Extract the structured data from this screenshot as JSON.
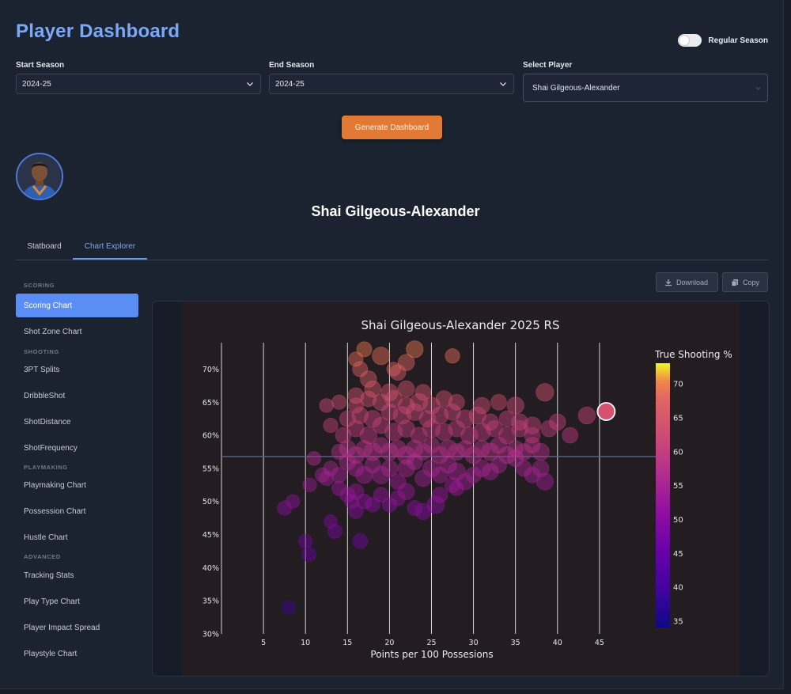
{
  "header": {
    "title": "Player Dashboard",
    "season_toggle_label": "Regular Season"
  },
  "filters": {
    "start_label": "Start Season",
    "start_value": "2024-25",
    "end_label": "End Season",
    "end_value": "2024-25",
    "player_label": "Select Player",
    "player_value": "Shai Gilgeous-Alexander"
  },
  "generate_label": "Generate Dashboard",
  "player": {
    "name": "Shai Gilgeous-Alexander"
  },
  "tabs": [
    {
      "label": "Statboard",
      "active": false
    },
    {
      "label": "Chart Explorer",
      "active": true
    }
  ],
  "sidebar": {
    "sections": [
      {
        "title": "SCORING",
        "items": [
          {
            "label": "Scoring Chart",
            "active": true
          },
          {
            "label": "Shot Zone Chart"
          }
        ]
      },
      {
        "title": "SHOOTING",
        "items": [
          {
            "label": "3PT Splits"
          },
          {
            "label": "DribbleShot"
          },
          {
            "label": "ShotDistance"
          },
          {
            "label": "ShotFrequency"
          }
        ]
      },
      {
        "title": "PLAYMAKING",
        "items": [
          {
            "label": "Playmaking Chart"
          },
          {
            "label": "Possession Chart"
          },
          {
            "label": "Hustle Chart"
          }
        ]
      },
      {
        "title": "ADVANCED",
        "items": [
          {
            "label": "Tracking Stats"
          },
          {
            "label": "Play Type Chart"
          },
          {
            "label": "Player Impact Spread"
          },
          {
            "label": "Playstyle Chart"
          }
        ]
      }
    ]
  },
  "toolbar": {
    "download_label": "Download",
    "copy_label": "Copy"
  },
  "colors": {
    "accent": "#5a8ef5",
    "generate_button": "#e07a34",
    "chart_bg": "#231d21"
  },
  "chart_data": {
    "type": "scatter",
    "title": "Shai Gilgeous-Alexander 2025 RS",
    "xlabel": "Points per 100 Possesions",
    "ylabel": "",
    "xlim": [
      0,
      50
    ],
    "ylim": [
      30,
      74
    ],
    "x_ticks": [
      5,
      10,
      15,
      20,
      25,
      30,
      35,
      40,
      45
    ],
    "y_ticks": [
      30,
      35,
      40,
      45,
      50,
      55,
      60,
      65,
      70
    ],
    "y_tick_suffix": "%",
    "reference_line_y": 56.8,
    "grid": "vertical",
    "colorbar": {
      "title": "True Shooting %",
      "range": [
        34,
        73
      ],
      "ticks": [
        35,
        40,
        45,
        50,
        55,
        60,
        65,
        70
      ],
      "scale": "plasma",
      "placement": "right"
    },
    "highlight": {
      "x": 45.8,
      "y": 63.6,
      "ts": 64
    },
    "points": [
      [
        8,
        34,
        0.7
      ],
      [
        10,
        44,
        0.7
      ],
      [
        10.4,
        42,
        0.8
      ],
      [
        7.5,
        49,
        0.8
      ],
      [
        8.5,
        50,
        0.7
      ],
      [
        10.5,
        52.5,
        0.7
      ],
      [
        12,
        54,
        0.8
      ],
      [
        13,
        47,
        0.6
      ],
      [
        13.5,
        45.5,
        0.8
      ],
      [
        16,
        48.5,
        0.8
      ],
      [
        15.5,
        50,
        0.7
      ],
      [
        16.5,
        44,
        0.9
      ],
      [
        11,
        56.5,
        0.7
      ],
      [
        12.5,
        53.5,
        0.8
      ],
      [
        14,
        52,
        0.8
      ],
      [
        15,
        51,
        0.9
      ],
      [
        16,
        51.5,
        1
      ],
      [
        17,
        50,
        0.9
      ],
      [
        18,
        49.5,
        0.8
      ],
      [
        19,
        51,
        0.9
      ],
      [
        20,
        49.5,
        0.8
      ],
      [
        21,
        50.5,
        0.9
      ],
      [
        22,
        51.5,
        1.1
      ],
      [
        23,
        49,
        0.9
      ],
      [
        24,
        48.5,
        1.1
      ],
      [
        25.5,
        49.5,
        1.3
      ],
      [
        26,
        51,
        1
      ],
      [
        27.5,
        52.5,
        0.9
      ],
      [
        28,
        52,
        0.8
      ],
      [
        13,
        55,
        0.8
      ],
      [
        14,
        54,
        1
      ],
      [
        15,
        56,
        1.1
      ],
      [
        16,
        55,
        1
      ],
      [
        17,
        54,
        1.2
      ],
      [
        18,
        55.5,
        1
      ],
      [
        19,
        54,
        1.3
      ],
      [
        20,
        55,
        1.1
      ],
      [
        21,
        53,
        1
      ],
      [
        22,
        55,
        1.2
      ],
      [
        23,
        56,
        1
      ],
      [
        24,
        53.5,
        1.1
      ],
      [
        25,
        55,
        1.2
      ],
      [
        26,
        54,
        1
      ],
      [
        27,
        55.5,
        1.1
      ],
      [
        28,
        54.5,
        1.3
      ],
      [
        29,
        53,
        1.1
      ],
      [
        30,
        54,
        1
      ],
      [
        31,
        55,
        1.2
      ],
      [
        32,
        54.5,
        1.1
      ],
      [
        33,
        55.5,
        1
      ],
      [
        35,
        56.5,
        1.1
      ],
      [
        36,
        55,
        1
      ],
      [
        37,
        54,
        1
      ],
      [
        38,
        55,
        1.1
      ],
      [
        38.5,
        53,
        1.2
      ],
      [
        14,
        57.5,
        0.9
      ],
      [
        15,
        58,
        1.1
      ],
      [
        16,
        57,
        1.2
      ],
      [
        17,
        58,
        1.1
      ],
      [
        18,
        57.5,
        1.3
      ],
      [
        19,
        58.5,
        1
      ],
      [
        20,
        57.5,
        1.2
      ],
      [
        21,
        58,
        1.1
      ],
      [
        22,
        57,
        1.3
      ],
      [
        23,
        58,
        1.2
      ],
      [
        24,
        57.5,
        1.1
      ],
      [
        25,
        58.5,
        1
      ],
      [
        26,
        57,
        1.2
      ],
      [
        27,
        58,
        1.3
      ],
      [
        28,
        57.5,
        1.1
      ],
      [
        29,
        58,
        1
      ],
      [
        30,
        57,
        1.2
      ],
      [
        31,
        58,
        1.1
      ],
      [
        32,
        57.5,
        1.3
      ],
      [
        33,
        58.5,
        1.1
      ],
      [
        34,
        57,
        1.2
      ],
      [
        35,
        58,
        1
      ],
      [
        36,
        57.5,
        1.1
      ],
      [
        37,
        58.5,
        1
      ],
      [
        38,
        57.5,
        1.2
      ],
      [
        14.5,
        60,
        1
      ],
      [
        16,
        61,
        1.1
      ],
      [
        17.5,
        60,
        1.2
      ],
      [
        19,
        61.5,
        1.1
      ],
      [
        20.5,
        60.5,
        1.3
      ],
      [
        22,
        61,
        1.2
      ],
      [
        23.5,
        60,
        1.1
      ],
      [
        25,
        61,
        1.3
      ],
      [
        26.5,
        60.5,
        1.2
      ],
      [
        28,
        61,
        1.1
      ],
      [
        29.5,
        60,
        1.2
      ],
      [
        31,
        60.5,
        1.3
      ],
      [
        32.5,
        61,
        1.1
      ],
      [
        34,
        60,
        1.2
      ],
      [
        35.5,
        61,
        1.1
      ],
      [
        37,
        60,
        1
      ],
      [
        15,
        62.5,
        1
      ],
      [
        16.5,
        63,
        1.1
      ],
      [
        18,
        62.5,
        1.2
      ],
      [
        20,
        63.5,
        1.1
      ],
      [
        21.5,
        63,
        1.3
      ],
      [
        23,
        63.5,
        1.2
      ],
      [
        24.5,
        62.5,
        1.1
      ],
      [
        26,
        63,
        1.2
      ],
      [
        27.5,
        63.5,
        1.1
      ],
      [
        29,
        62.5,
        1.3
      ],
      [
        30.5,
        63,
        1.2
      ],
      [
        32,
        62,
        1.1
      ],
      [
        34,
        62.5,
        1
      ],
      [
        35.5,
        62,
        1.1
      ],
      [
        37,
        61.5,
        1.2
      ],
      [
        39,
        61,
        1.1
      ],
      [
        40,
        62,
        1.1
      ],
      [
        13,
        61.5,
        0.8
      ],
      [
        12.5,
        64.5,
        0.7
      ],
      [
        14,
        65,
        0.8
      ],
      [
        16,
        64.5,
        0.9
      ],
      [
        17.5,
        65.5,
        1
      ],
      [
        19,
        65,
        1.1
      ],
      [
        20.5,
        65.5,
        1.2
      ],
      [
        22,
        64.5,
        1.1
      ],
      [
        23.5,
        65,
        1.3
      ],
      [
        25,
        64.5,
        1.2
      ],
      [
        26.5,
        65.5,
        1.1
      ],
      [
        28,
        65,
        1
      ],
      [
        31,
        64.5,
        1.1
      ],
      [
        33,
        65,
        1
      ],
      [
        35,
        64.5,
        1.2
      ],
      [
        41.5,
        60,
        1
      ],
      [
        43.5,
        63,
        1.2
      ],
      [
        38.5,
        66.5,
        1.3
      ],
      [
        16,
        66,
        1
      ],
      [
        18,
        67,
        1.1
      ],
      [
        20,
        66.5,
        1.2
      ],
      [
        22,
        67,
        1.1
      ],
      [
        24,
        66.5,
        1
      ],
      [
        16.5,
        70,
        0.9
      ],
      [
        17.5,
        68.5,
        1.1
      ],
      [
        19,
        72,
        1.3
      ],
      [
        21,
        69.5,
        1
      ],
      [
        22,
        71,
        1.1
      ],
      [
        23,
        73,
        1.2
      ],
      [
        16,
        71.5,
        0.8
      ],
      [
        17,
        73,
        0.9
      ],
      [
        20.5,
        70,
        0.7
      ],
      [
        27.5,
        72,
        0.8
      ]
    ]
  }
}
